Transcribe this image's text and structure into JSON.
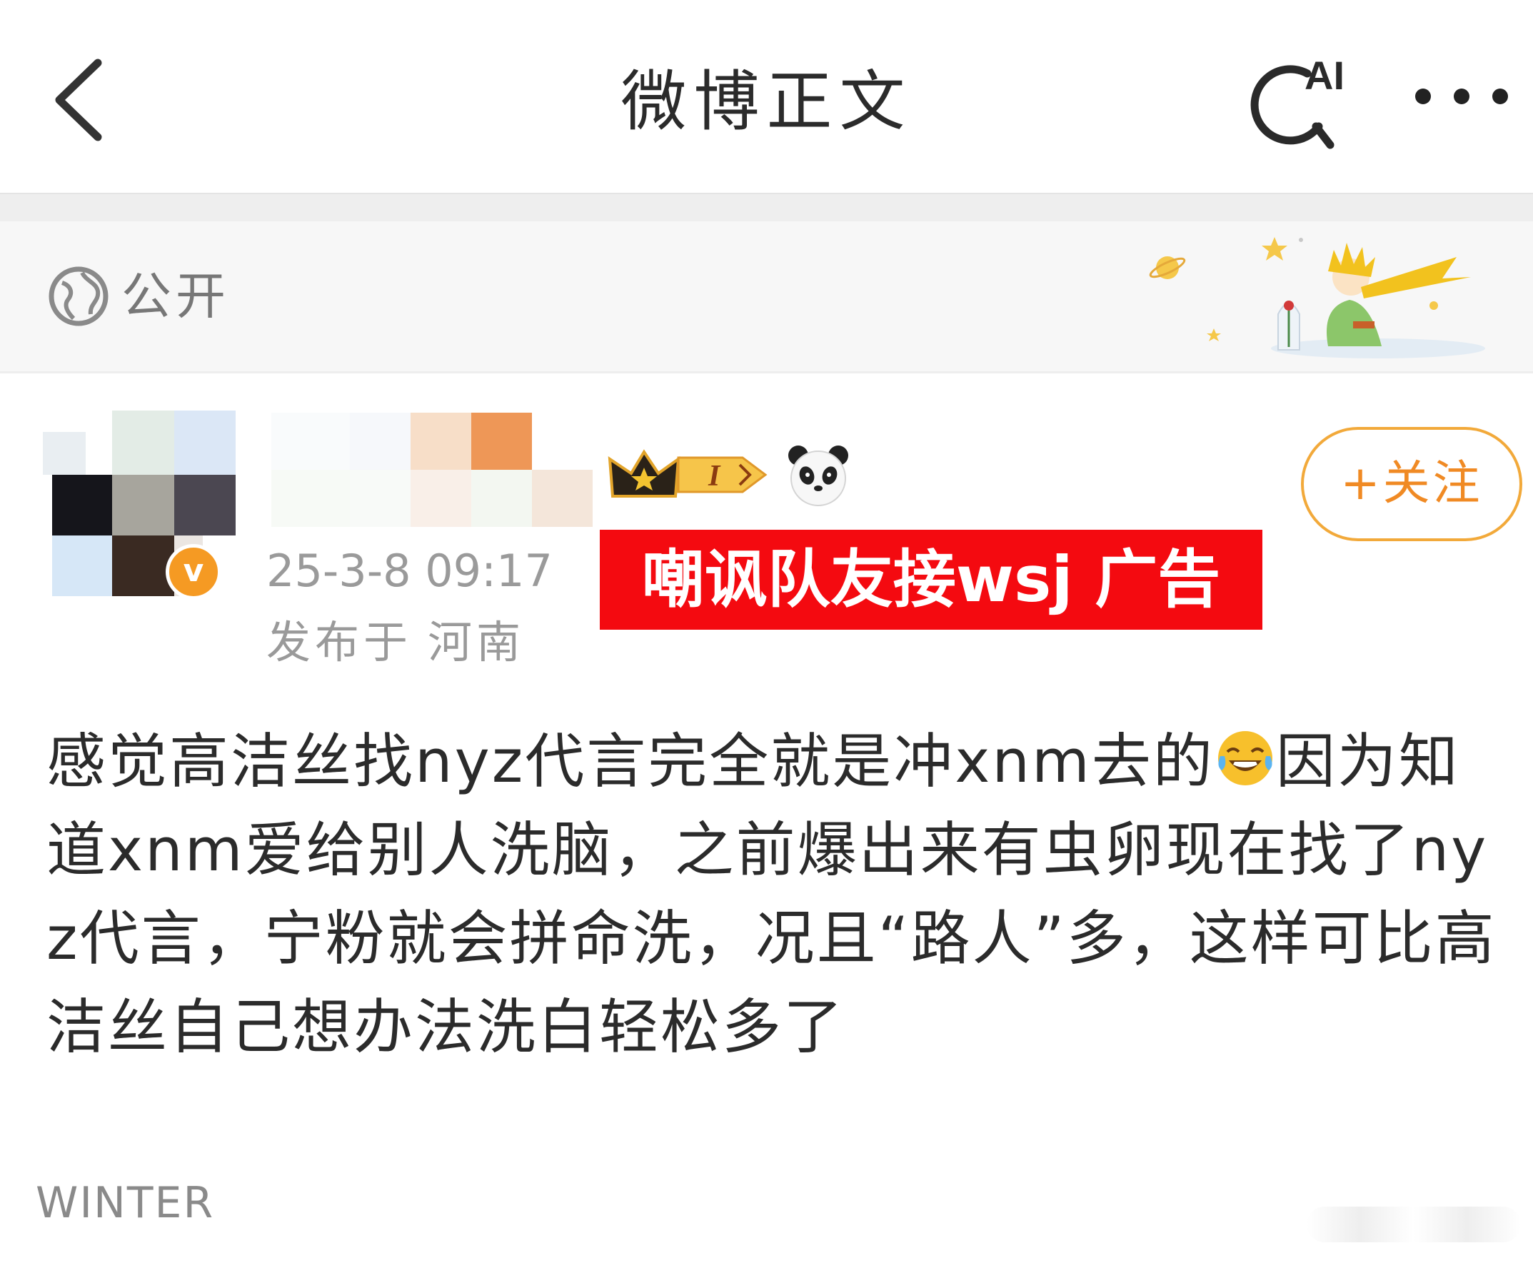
{
  "nav": {
    "title": "微博正文",
    "ai_label": "AI"
  },
  "visibility": {
    "label": "公开"
  },
  "post": {
    "time": "25-3-8 09:17",
    "location_prefix": "发布于",
    "location": "河南",
    "overlay_caption": "嘲讽队友接wsj 广告",
    "follow_label": "+关注",
    "verified_mark": "v",
    "crown_level": "I",
    "body_part1": "感觉高洁丝找nyz代言完全就是冲xnm去的",
    "emoji_name": "laughing-tears-emoji",
    "body_part2": "因为知道xnm爱给别人洗脑，之前爆出来有虫卵现在找了nyz代言，宁粉就会拼命洗，况且“路人”多，这样可比高洁丝自己想办法洗白轻松多了"
  },
  "watermark": "WINTER",
  "colors": {
    "caption_bg": "#f40a10",
    "follow_accent": "#f08a24",
    "verified": "#f59a23"
  }
}
